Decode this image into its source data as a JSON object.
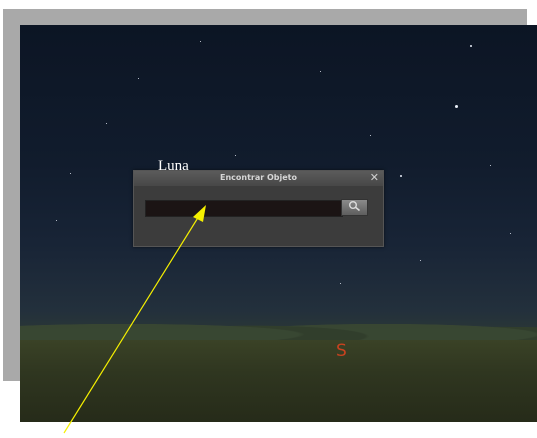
{
  "annotation": {
    "label": "Luna",
    "arrow_color": "#f5f000"
  },
  "dialog": {
    "title": "Encontrar Objeto",
    "close_glyph": "✕",
    "search_value": "",
    "search_icon": "search-icon"
  },
  "sky": {
    "cardinal": "S",
    "cardinal_color": "#c8421f"
  }
}
